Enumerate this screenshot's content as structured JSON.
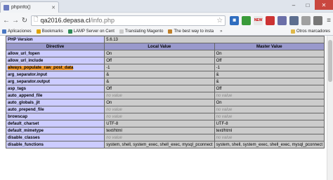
{
  "browser": {
    "tab_title": "phpinfo()",
    "url_host": "qa2016.depasa.cl",
    "url_path": "/info.php",
    "window_controls": [
      "–",
      "□",
      "✕"
    ]
  },
  "extensions": [
    {
      "name": "trello-icon",
      "color": "#2f6dbf",
      "label": "▦"
    },
    {
      "name": "evernote-icon",
      "color": "#3a9b3a",
      "label": ""
    },
    {
      "name": "rss-icon",
      "color": "#e8e8e8",
      "label": "NEW"
    },
    {
      "name": "feedly-icon",
      "color": "#cc3333",
      "label": ""
    },
    {
      "name": "shield-icon",
      "color": "#6b6fa8",
      "label": ""
    },
    {
      "name": "cube-icon",
      "color": "#5d6e8f",
      "label": ""
    },
    {
      "name": "puzzle-icon",
      "color": "#a0a0a0",
      "label": ""
    },
    {
      "name": "ghost-icon",
      "color": "#777777",
      "label": ""
    }
  ],
  "bookmarks": [
    {
      "label": "Aplicaciones",
      "icon": "apps-icon",
      "color": "#4a78c2"
    },
    {
      "label": "Bookmarks",
      "icon": "star-icon",
      "color": "#e0a400"
    },
    {
      "label": "LAMP Server on Cent",
      "icon": "lamp-icon",
      "color": "#2e8b57"
    },
    {
      "label": "Translating Magento",
      "icon": "page-icon",
      "color": "#cccccc"
    },
    {
      "label": "The best way to insta",
      "icon": "bookmark-icon",
      "color": "#c0802a"
    }
  ],
  "bookmarks_more": "»",
  "other_bookmarks": "Otros marcadores",
  "php_version": {
    "label": "PHP Version",
    "value": "5.6.13"
  },
  "table_headers": [
    "Directive",
    "Local Value",
    "Master Value"
  ],
  "directives": [
    {
      "name": "allow_url_fopen",
      "local": "On",
      "master": "On",
      "novalue": false
    },
    {
      "name": "allow_url_include",
      "local": "Off",
      "master": "Off",
      "novalue": false
    },
    {
      "name": "always_populate_raw_post_data",
      "local": "-1",
      "master": "-1",
      "novalue": false,
      "highlight": true
    },
    {
      "name": "arg_separator.input",
      "local": "&",
      "master": "&",
      "novalue": false
    },
    {
      "name": "arg_separator.output",
      "local": "&",
      "master": "&",
      "novalue": false
    },
    {
      "name": "asp_tags",
      "local": "Off",
      "master": "Off",
      "novalue": false
    },
    {
      "name": "auto_append_file",
      "local": "no value",
      "master": "no value",
      "novalue": true
    },
    {
      "name": "auto_globals_jit",
      "local": "On",
      "master": "On",
      "novalue": false
    },
    {
      "name": "auto_prepend_file",
      "local": "no value",
      "master": "no value",
      "novalue": true
    },
    {
      "name": "browscap",
      "local": "no value",
      "master": "no value",
      "novalue": true
    },
    {
      "name": "default_charset",
      "local": "UTF-8",
      "master": "UTF-8",
      "novalue": false
    },
    {
      "name": "default_mimetype",
      "local": "text/html",
      "master": "text/html",
      "novalue": false
    },
    {
      "name": "disable_classes",
      "local": "no value",
      "master": "no value",
      "novalue": true
    },
    {
      "name": "disable_functions",
      "local": "system, shell, system_exec, shell_exec, mysql_pconnect",
      "master": "system, shell, system_exec, shell_exec, mysql_pconnect",
      "novalue": false
    }
  ]
}
